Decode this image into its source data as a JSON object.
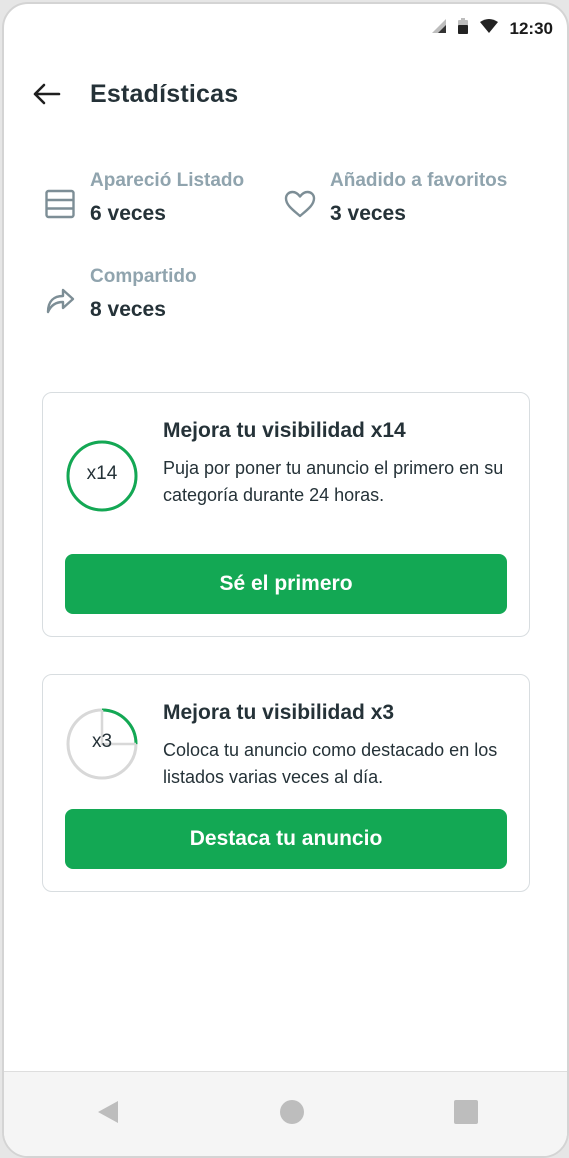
{
  "status_bar": {
    "time": "12:30"
  },
  "header": {
    "title": "Estadísticas"
  },
  "stats": [
    {
      "label": "Apareció Listado",
      "value": "6 veces",
      "icon": "list-icon"
    },
    {
      "label": "Añadido a favoritos",
      "value": "3 veces",
      "icon": "heart-icon"
    },
    {
      "label": "Compartido",
      "value": "8 veces",
      "icon": "share-icon"
    }
  ],
  "cards": [
    {
      "badge": "x14",
      "title": "Mejora tu visibilidad x14",
      "description": "Puja por poner tu anuncio el primero en su categoría durante 24 horas.",
      "button": "Sé el primero",
      "ring_fill": 1.0
    },
    {
      "badge": "x3",
      "title": "Mejora tu visibilidad x3",
      "description": "Coloca tu anuncio como destacado en los listados varias veces al día.",
      "button": "Destaca tu anuncio",
      "ring_fill": 0.25
    }
  ],
  "colors": {
    "accent": "#13a854",
    "text_dark": "#253238",
    "text_muted": "#90a4ae",
    "ring_track": "#d8d8d8"
  }
}
